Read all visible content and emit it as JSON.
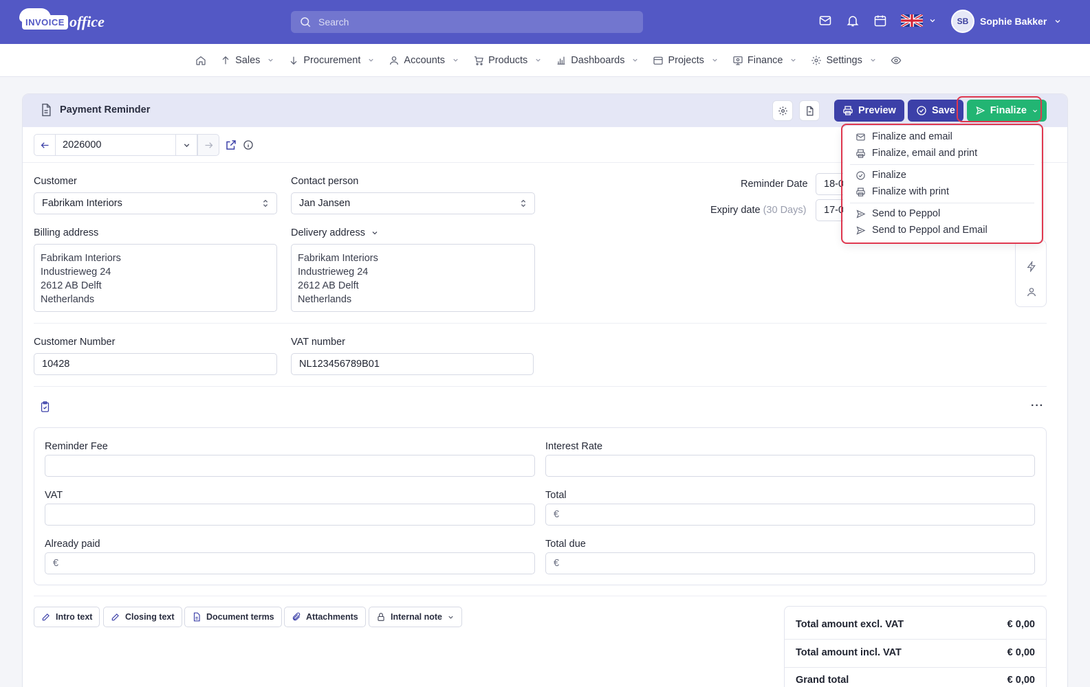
{
  "brand": {
    "logo_box": "INVOICE",
    "logo_script": "office"
  },
  "search": {
    "placeholder": "Search"
  },
  "user": {
    "initials": "SB",
    "name": "Sophie Bakker"
  },
  "nav": [
    {
      "label": "Sales"
    },
    {
      "label": "Procurement"
    },
    {
      "label": "Accounts"
    },
    {
      "label": "Products"
    },
    {
      "label": "Dashboards"
    },
    {
      "label": "Projects"
    },
    {
      "label": "Finance"
    },
    {
      "label": "Settings"
    }
  ],
  "header": {
    "title": "Payment Reminder",
    "preview": "Preview",
    "save": "Save",
    "finalize": "Finalize"
  },
  "number": {
    "value": "2026000"
  },
  "form": {
    "customer_label": "Customer",
    "customer_value": "Fabrikam Interiors",
    "contact_label": "Contact person",
    "contact_value": "Jan Jansen",
    "billing_label": "Billing address",
    "billing_lines": [
      "Fabrikam Interiors",
      "Industrieweg 24",
      "2612 AB Delft",
      "Netherlands"
    ],
    "delivery_label": "Delivery address",
    "delivery_lines": [
      "Fabrikam Interiors",
      "Industrieweg 24",
      "2612 AB Delft",
      "Netherlands"
    ],
    "reminder_date_label": "Reminder Date",
    "reminder_date_value": "18-0",
    "expiry_label": "Expiry date",
    "expiry_hint": "(30 Days)",
    "expiry_value": "17-0",
    "customer_number_label": "Customer Number",
    "customer_number_value": "10428",
    "vat_number_label": "VAT number",
    "vat_number_value": "NL123456789B01"
  },
  "panel": {
    "reminder_fee_label": "Reminder Fee",
    "interest_rate_label": "Interest Rate",
    "vat_label": "VAT",
    "total_label": "Total",
    "already_paid_label": "Already paid",
    "total_due_label": "Total due",
    "currency": "€"
  },
  "tabs": {
    "intro": "Intro text",
    "closing": "Closing text",
    "terms": "Document terms",
    "attachments": "Attachments",
    "internal_note": "Internal note"
  },
  "totals": {
    "excl_label": "Total amount excl. VAT",
    "excl_value": "€ 0,00",
    "incl_label": "Total amount incl. VAT",
    "incl_value": "€ 0,00",
    "grand_label": "Grand total",
    "grand_value": "€ 0,00"
  },
  "finalize_menu": {
    "finalize_email": "Finalize and email",
    "finalize_email_print": "Finalize, email and print",
    "finalize": "Finalize",
    "finalize_print": "Finalize with print",
    "peppol": "Send to Peppol",
    "peppol_email": "Send to Peppol and Email"
  },
  "colors": {
    "topbar": "#5358c5",
    "primary_button": "#3c40a8",
    "finalize_green": "#22b573",
    "highlight_red": "#e0384f"
  }
}
